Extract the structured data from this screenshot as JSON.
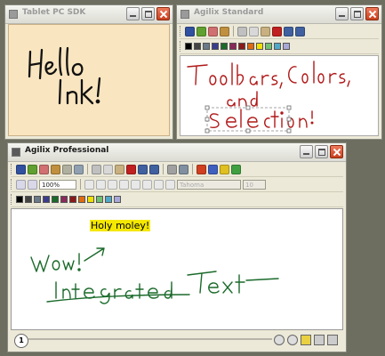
{
  "windows": {
    "sdk": {
      "title": "Tablet PC SDK",
      "ink_text": "Hello Ink!"
    },
    "standard": {
      "title": "Agilix Standard",
      "ink_text": "Toolbars, Colors, and Selection"
    },
    "pro": {
      "title": "Agilix Professional",
      "zoom_value": "100%",
      "font_value": "Tahoma",
      "size_value": "10",
      "typed_text": "Holy moley!",
      "ink_text": "Wow! Integrated Text",
      "page_tab": "1"
    }
  },
  "palette": [
    "#000000",
    "#444444",
    "#6a7a8a",
    "#3c3c8c",
    "#1c6a2a",
    "#8a2a5a",
    "#8a1a1a",
    "#e06a10",
    "#f0e000",
    "#70c070",
    "#50a8c8",
    "#a8a8d8"
  ],
  "icons": {
    "pen": "pen-icon",
    "highlighter": "highlighter-icon",
    "eraser": "eraser-icon",
    "lasso": "lasso-icon",
    "cut": "cut-icon",
    "copy": "copy-icon",
    "paste": "paste-icon",
    "delete": "delete-icon",
    "undo": "undo-icon",
    "redo": "redo-icon",
    "zoom_in": "zoom-in-icon",
    "zoom_out": "zoom-out-icon"
  }
}
